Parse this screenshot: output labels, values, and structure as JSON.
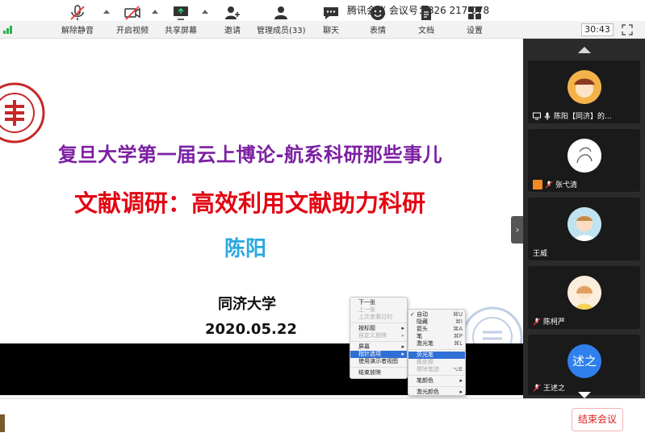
{
  "window": {
    "title": "腾讯会议 会议号：826 217 078"
  },
  "status": {
    "timer": "30:43"
  },
  "slide": {
    "title": "复旦大学第一届云上博论-航系科研那些事儿",
    "subtitle": "文献调研：高效利用文献助力科研",
    "presenter": "陈阳",
    "school": "同济大学",
    "date": "2020.05.22"
  },
  "context_menu": {
    "items": [
      {
        "label": "下一张",
        "disabled": false
      },
      {
        "label": "上一张",
        "disabled": true
      },
      {
        "label": "上次查看过的",
        "disabled": true
      },
      {
        "label": "按标题",
        "disabled": false,
        "submenu": true
      },
      {
        "label": "自定义放映",
        "disabled": true,
        "submenu": true
      },
      {
        "label": "屏幕",
        "disabled": false,
        "submenu": true
      },
      {
        "label": "指针选项",
        "disabled": false,
        "submenu": true,
        "active": true
      },
      {
        "label": "使用演示者视图",
        "disabled": false
      },
      {
        "label": "结束放映",
        "disabled": false
      }
    ]
  },
  "pointer_menu": {
    "items": [
      {
        "label": "自动",
        "shortcut": "⌘U",
        "checked": true
      },
      {
        "label": "隐藏",
        "shortcut": "⌘I"
      },
      {
        "label": "箭头",
        "shortcut": "⌘A"
      },
      {
        "label": "笔",
        "shortcut": "⌘P"
      },
      {
        "label": "激光笔",
        "shortcut": "⌘L"
      },
      {
        "label": "荧光笔",
        "active": true
      },
      {
        "label": "橡皮擦",
        "disabled": true
      },
      {
        "label": "擦除笔迹",
        "shortcut": "⌥E",
        "disabled": true
      },
      {
        "label": "笔颜色",
        "submenu": true
      },
      {
        "label": "激光颜色",
        "submenu": true
      }
    ]
  },
  "participants": [
    {
      "name": "陈阳【同济】的...",
      "mic": "on",
      "screen_share": true
    },
    {
      "name": "张弋清",
      "mic": "muted",
      "has_badge": true
    },
    {
      "name": "王威",
      "mic": "none"
    },
    {
      "name": "陈柯严",
      "mic": "muted"
    },
    {
      "name": "王述之",
      "mic": "muted",
      "avatar_text": "述之"
    }
  ],
  "toolbar": {
    "unmute": "解除静音",
    "start_video": "开启视频",
    "share_screen": "共享屏幕",
    "invite": "邀请",
    "manage_members": "管理成员(33)",
    "chat": "聊天",
    "reactions": "表情",
    "docs": "文档",
    "settings": "设置",
    "end_meeting": "结束会议"
  },
  "colors": {
    "slide_title": "#7b1fa2",
    "slide_subtitle": "#e30613",
    "slide_name": "#29a8e0",
    "end_meeting": "#e02020",
    "signal": "#27b148",
    "menu_highlight": "#2f6fd6",
    "panel_bg": "#2b2b2b"
  }
}
